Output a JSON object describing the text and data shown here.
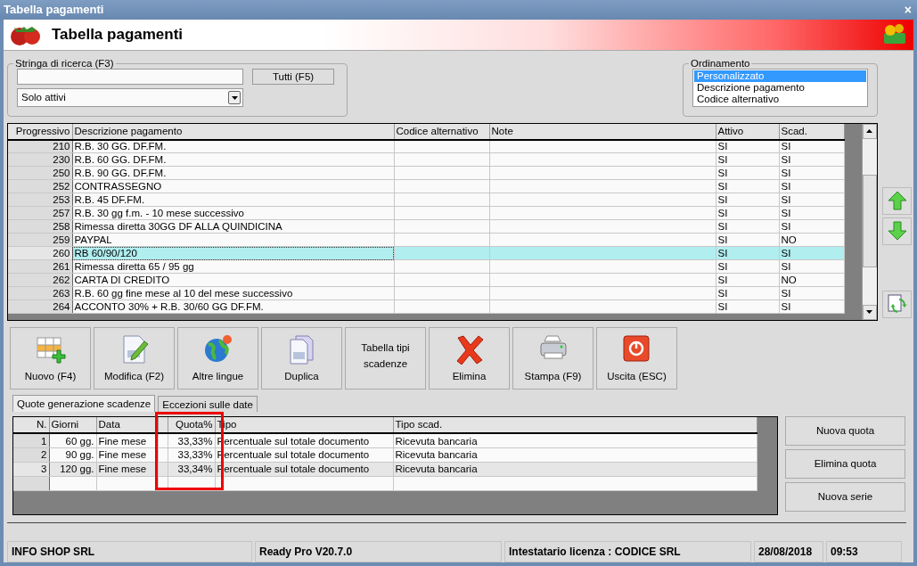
{
  "window": {
    "title": "Tabella pagamenti",
    "close": "×"
  },
  "header": {
    "title": "Tabella pagamenti"
  },
  "search": {
    "label": "Stringa di ricerca (F3)",
    "value_button": "Tutti (F5)",
    "filter": "Solo attivi"
  },
  "ordering": {
    "label": "Ordinamento",
    "options": [
      {
        "label": "Personalizzato",
        "selected": true
      },
      {
        "label": "Descrizione pagamento",
        "selected": false
      },
      {
        "label": "Codice alternativo",
        "selected": false
      }
    ]
  },
  "table": {
    "columns": [
      "Progressivo",
      "Descrizione pagamento",
      "Codice alternativo",
      "Note",
      "Attivo",
      "Scad."
    ],
    "rows": [
      {
        "progressivo": "210",
        "descrizione": "R.B. 30 GG. DF.FM.",
        "attivo": "SI",
        "scad": "SI",
        "selected": false
      },
      {
        "progressivo": "230",
        "descrizione": "R.B. 60 GG. DF.FM.",
        "attivo": "SI",
        "scad": "SI",
        "selected": false
      },
      {
        "progressivo": "250",
        "descrizione": "R.B. 90 GG. DF.FM.",
        "attivo": "SI",
        "scad": "SI",
        "selected": false
      },
      {
        "progressivo": "252",
        "descrizione": "CONTRASSEGNO",
        "attivo": "SI",
        "scad": "SI",
        "selected": false
      },
      {
        "progressivo": "253",
        "descrizione": "R.B. 45 DF.FM.",
        "attivo": "SI",
        "scad": "SI",
        "selected": false
      },
      {
        "progressivo": "257",
        "descrizione": "R.B. 30 gg f.m. - 10 mese successivo",
        "attivo": "SI",
        "scad": "SI",
        "selected": false
      },
      {
        "progressivo": "258",
        "descrizione": "Rimessa diretta 30GG DF ALLA QUINDICINA",
        "attivo": "SI",
        "scad": "SI",
        "selected": false
      },
      {
        "progressivo": "259",
        "descrizione": "PAYPAL",
        "attivo": "SI",
        "scad": "NO",
        "selected": false
      },
      {
        "progressivo": "260",
        "descrizione": "RB 60/90/120",
        "attivo": "SI",
        "scad": "SI",
        "selected": true
      },
      {
        "progressivo": "261",
        "descrizione": "Rimessa diretta 65 / 95 gg",
        "attivo": "SI",
        "scad": "SI",
        "selected": false
      },
      {
        "progressivo": "262",
        "descrizione": "CARTA DI CREDITO",
        "attivo": "SI",
        "scad": "NO",
        "selected": false
      },
      {
        "progressivo": "263",
        "descrizione": "R.B. 60 gg fine mese al 10 del mese successivo",
        "attivo": "SI",
        "scad": "SI",
        "selected": false
      },
      {
        "progressivo": "264",
        "descrizione": "ACCONTO 30% + R.B. 30/60 GG DF.FM.",
        "attivo": "SI",
        "scad": "SI",
        "selected": false
      }
    ]
  },
  "toolbar": [
    {
      "label": "Nuovo (F4)",
      "kind": "new"
    },
    {
      "label": "Modifica (F2)",
      "kind": "edit"
    },
    {
      "label": "Altre lingue",
      "kind": "globe"
    },
    {
      "label": "Duplica",
      "kind": "copy"
    },
    {
      "label": "Tabella tipi scadenze",
      "kind": "text"
    },
    {
      "label": "Elimina",
      "kind": "delete"
    },
    {
      "label": "Stampa (F9)",
      "kind": "print"
    },
    {
      "label": "Uscita (ESC)",
      "kind": "exit"
    }
  ],
  "tabs": [
    {
      "label": "Quote generazione scadenze",
      "selected": true
    },
    {
      "label": "Eccezioni sulle date",
      "selected": false
    }
  ],
  "quotas": {
    "columns": [
      "N.",
      "Giorni",
      "Data",
      "Quota%",
      "Tipo",
      "Tipo scad."
    ],
    "rows": [
      {
        "n": "1",
        "giorni": "60 gg.",
        "data": "Fine mese",
        "quota": "33,33%",
        "tipo": "Percentuale sul totale documento",
        "tipo_scad": "Ricevuta bancaria",
        "selected": false
      },
      {
        "n": "2",
        "giorni": "90 gg.",
        "data": "Fine mese",
        "quota": "33,33%",
        "tipo": "Percentuale sul totale documento",
        "tipo_scad": "Ricevuta bancaria",
        "selected": false
      },
      {
        "n": "3",
        "giorni": "120 gg.",
        "data": "Fine mese",
        "quota": "33,34%",
        "tipo": "Percentuale sul totale documento",
        "tipo_scad": "Ricevuta bancaria",
        "selected": true
      }
    ]
  },
  "quota_buttons": [
    "Nuova quota",
    "Elimina quota",
    "Nuova serie"
  ],
  "highlight_box": {
    "shown": true
  },
  "status_bar": [
    "INFO SHOP SRL",
    "Ready Pro V20.7.0",
    "Intestatario licenza : CODICE SRL",
    "28/08/2018",
    "09:53"
  ]
}
